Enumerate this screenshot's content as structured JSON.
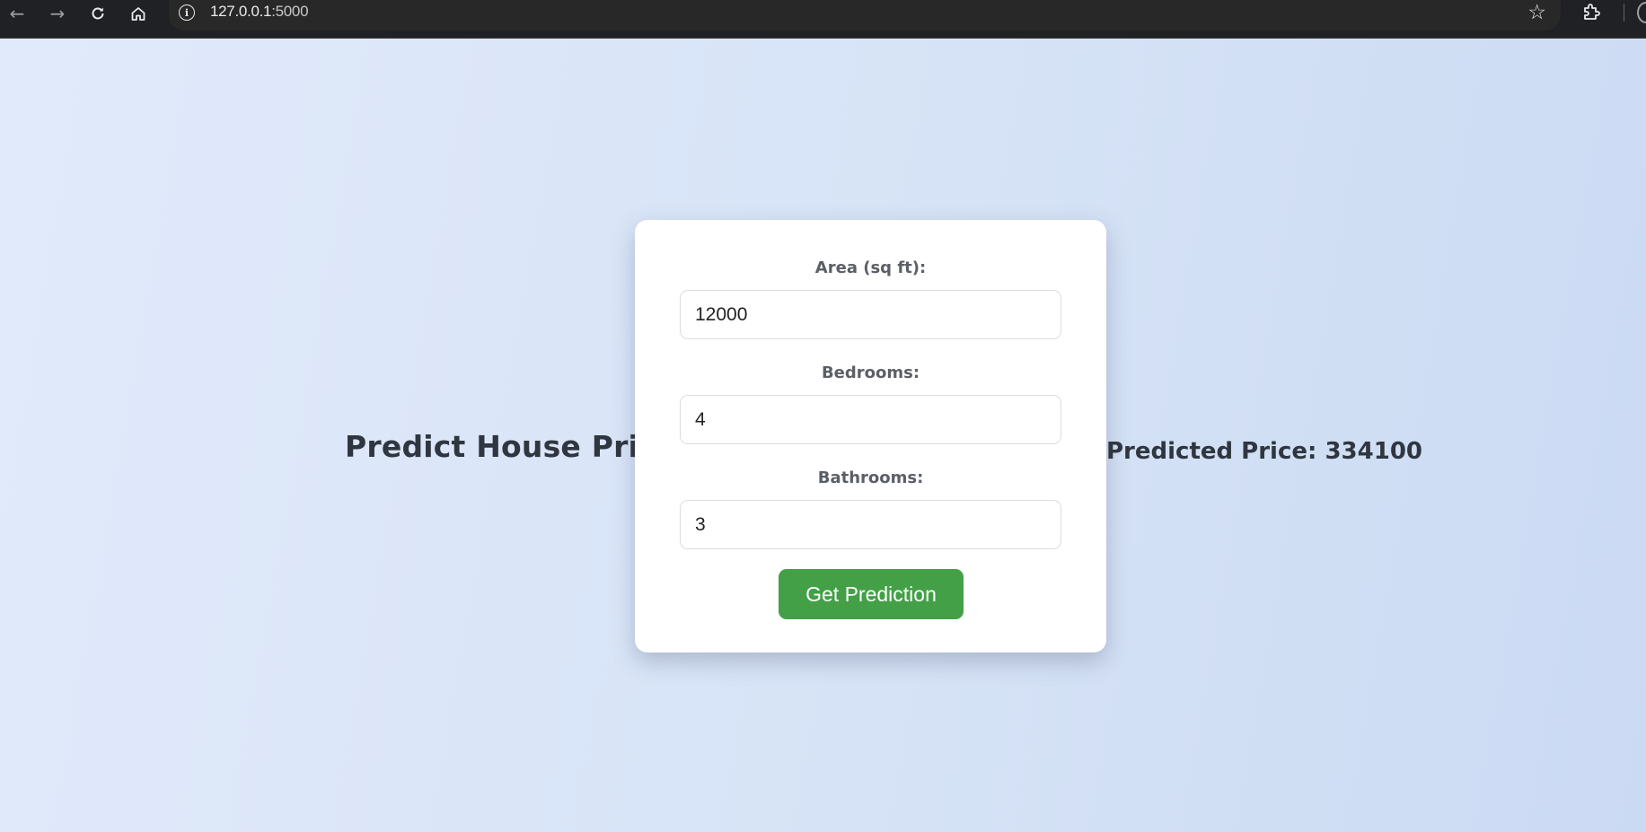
{
  "browser": {
    "url_host": "127.0.0.1",
    "url_port": ":5000",
    "icons": {
      "back": "arrow-left-icon",
      "forward": "arrow-right-icon",
      "reload": "reload-icon",
      "home": "home-icon",
      "site_info": "info-icon",
      "bookmark": "star-icon",
      "extensions": "puzzle-icon"
    }
  },
  "page": {
    "heading": "Predict House Prices",
    "result": "Predicted Price: 334100"
  },
  "form": {
    "area": {
      "label": "Area (sq ft):",
      "value": "12000"
    },
    "bedrooms": {
      "label": "Bedrooms:",
      "value": "4"
    },
    "bathrooms": {
      "label": "Bathrooms:",
      "value": "3"
    },
    "submit_label": "Get Prediction"
  },
  "colors": {
    "button": "#43a047",
    "background": "#dde8f8",
    "card": "#ffffff",
    "text": "#2f3640"
  }
}
